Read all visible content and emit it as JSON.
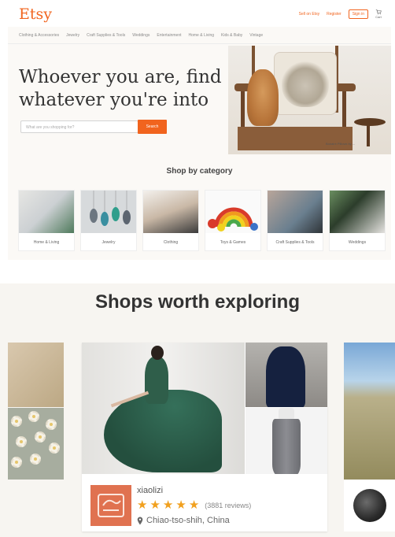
{
  "etsy_header": {
    "logo": "Etsy",
    "sell_link": "Sell on Etsy",
    "register_link": "Register",
    "signin_button": "Sign in",
    "cart_label": "Cart"
  },
  "nav": {
    "items": [
      "Clothing & Accessories",
      "Jewelry",
      "Craft Supplies & Tools",
      "Weddings",
      "Entertainment",
      "Home & Living",
      "Kids & Baby",
      "Vintage"
    ]
  },
  "hero": {
    "headline": "Whoever you are, find whatever you're into",
    "search_placeholder": "What are you shopping for?",
    "search_button": "Search",
    "caption": "Bonaire Pillows by ..."
  },
  "categories": {
    "title": "Shop by category",
    "items": [
      "Home & Living",
      "Jewelry",
      "Clothing",
      "Toys & Games",
      "Craft Supplies & Tools",
      "Weddings"
    ]
  },
  "shops_section": {
    "title": "Shops worth exploring",
    "featured_shop": {
      "name": "xiaolizi",
      "rating": 5,
      "reviews": "(3881 reviews)",
      "location": "Chiao-tso-shih, China"
    }
  },
  "colors": {
    "brand_orange": "#f1641e",
    "star": "#f1a01e"
  },
  "icons": [
    "cart-icon",
    "star-icon",
    "location-pin-icon"
  ]
}
